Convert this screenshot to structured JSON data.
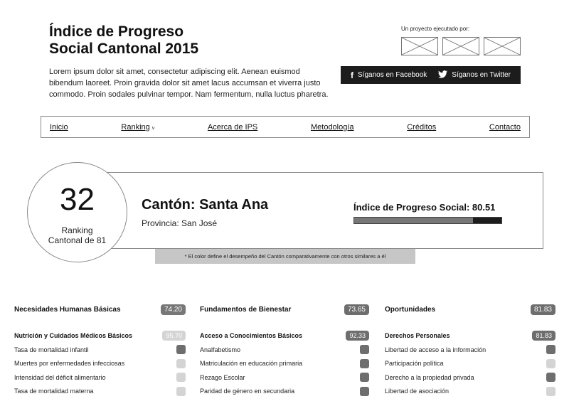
{
  "header": {
    "title_line1": "Índice de Progreso",
    "title_line2": "Social Cantonal 2015",
    "intro": "Lorem ipsum dolor sit amet, consectetur adipiscing elit. Aenean euismod bibendum laoreet. Proin gravida dolor sit amet lacus accumsan et viverra justo commodo. Proin sodales pulvinar tempor. Nam fermentum, nulla luctus pharetra.",
    "sponsor_label": "Un proyecto ejecutado por:"
  },
  "social": {
    "facebook_label": "Síganos en Facebook",
    "twitter_label": "Síganos en Twitter"
  },
  "nav": {
    "items": [
      "Inicio",
      "Ranking",
      "Acerca de IPS",
      "Metodología",
      "Créditos",
      "Contacto"
    ]
  },
  "summary": {
    "rank": "32",
    "rank_label_1": "Ranking",
    "rank_label_2": "Cantonal de 81",
    "canton": "Cantón: Santa Ana",
    "provincia": "Provincia: San José",
    "ips_label": "Índice de Progreso Social: 80.51",
    "ips_value": 80.51,
    "note": "* El color define el desempeño del Cantón comparativamente con otros similares a él"
  },
  "dimensions": [
    {
      "name": "Necesidades Humanas Básicas",
      "score": "74.20",
      "score_color": "#777777",
      "component": "Nutrición y Cuidados Médicos Básicos",
      "component_score": "95.70",
      "component_color": "#d4d4d4",
      "indicators": [
        {
          "label": "Tasa de mortalidad infantil",
          "color": "#6e6e6e"
        },
        {
          "label": "Muertes por enfermedades infecciosas",
          "color": "#d4d4d4"
        },
        {
          "label": "Intensidad del déficit alimentario",
          "color": "#d4d4d4"
        },
        {
          "label": "Tasa de mortalidad materna",
          "color": "#d4d4d4"
        }
      ]
    },
    {
      "name": "Fundamentos de Bienestar",
      "score": "73.65",
      "score_color": "#6e6e6e",
      "component": "Acceso a Conocimientos Básicos",
      "component_score": "92.33",
      "component_color": "#6e6e6e",
      "indicators": [
        {
          "label": "Analfabetismo",
          "color": "#6e6e6e"
        },
        {
          "label": "Matriculación en educación primaria",
          "color": "#6e6e6e"
        },
        {
          "label": "Rezago Escolar",
          "color": "#6e6e6e"
        },
        {
          "label": "Paridad de género en secundaria",
          "color": "#6e6e6e"
        }
      ]
    },
    {
      "name": "Oportunidades",
      "score": "81.83",
      "score_color": "#6e6e6e",
      "component": "Derechos Personales",
      "component_score": "81.83",
      "component_color": "#6e6e6e",
      "indicators": [
        {
          "label": "Libertad de acceso a la información",
          "color": "#6e6e6e"
        },
        {
          "label": "Participación política",
          "color": "#d4d4d4"
        },
        {
          "label": "Derecho a la propiedad privada",
          "color": "#6e6e6e"
        },
        {
          "label": "Libertad de asociación",
          "color": "#d4d4d4"
        }
      ]
    }
  ]
}
